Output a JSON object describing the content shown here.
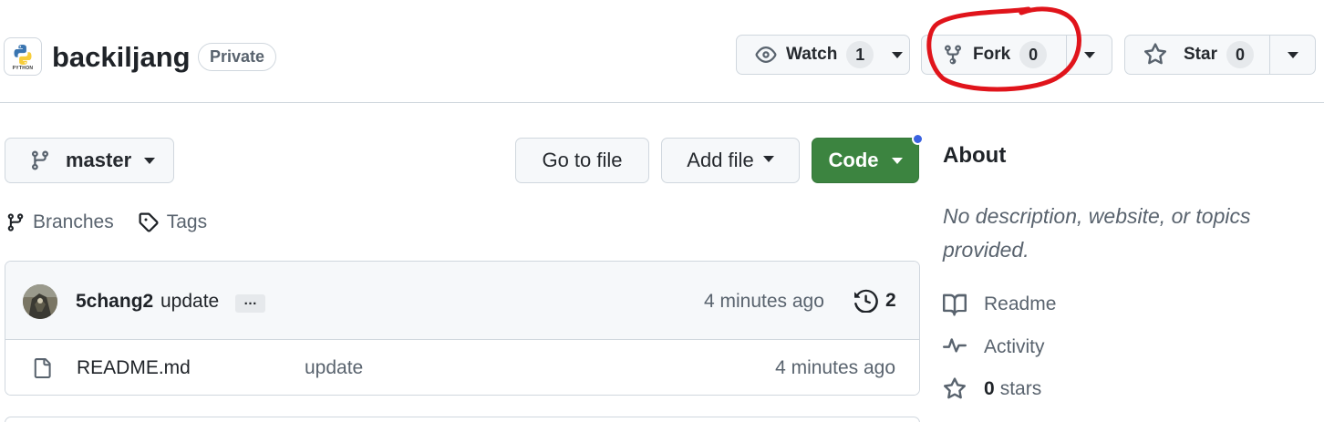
{
  "repo": {
    "name": "backiljang",
    "visibility": "Private",
    "avatar_caption": "PYTHON"
  },
  "actions": {
    "watch": {
      "label": "Watch",
      "count": "1"
    },
    "fork": {
      "label": "Fork",
      "count": "0"
    },
    "star": {
      "label": "Star",
      "count": "0"
    },
    "annotation_color": "#e0141b"
  },
  "toolbar": {
    "branch": "master",
    "go_to_file": "Go to file",
    "add_file": "Add file",
    "code": "Code",
    "code_color": "#3c8440"
  },
  "sublinks": {
    "branches": "Branches",
    "tags": "Tags"
  },
  "latest_commit": {
    "author": "5chang2",
    "message": "update",
    "ellipsis": "…",
    "time": "4 minutes ago",
    "history_count": "2"
  },
  "files": [
    {
      "name": "README.md",
      "commit_message": "update",
      "time": "4 minutes ago",
      "icon": "file-icon"
    }
  ],
  "about": {
    "title": "About",
    "description": "No description, website, or topics provided.",
    "readme": "Readme",
    "activity": "Activity",
    "stars_count": "0",
    "stars_label": "stars"
  }
}
